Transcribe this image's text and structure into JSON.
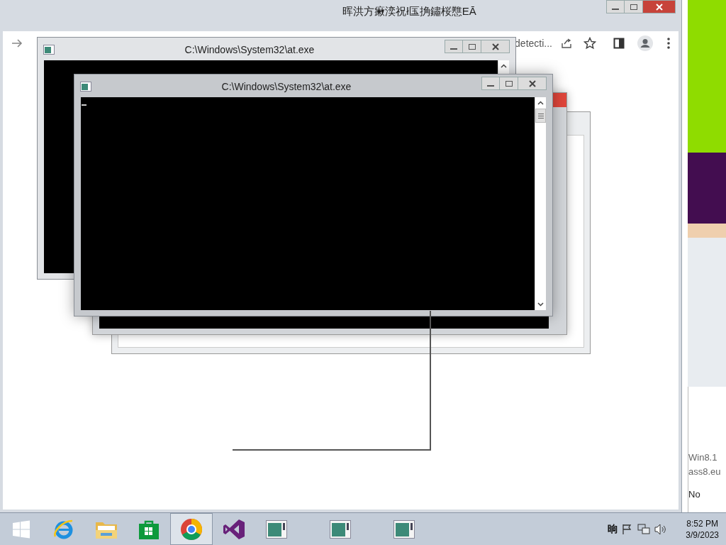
{
  "browser": {
    "title": "晖洪方瘷湙祝ł匤捔鏽桜戁EĀ",
    "address_text": "detecti..."
  },
  "console_windows": [
    {
      "title": "C:\\Windows\\System32\\at.exe",
      "active": false
    },
    {
      "title": "C:\\Windows\\System32\\at.exe",
      "active": true
    }
  ],
  "side_panel": {
    "lines": [
      "Win8.1",
      "ass8.eu",
      "No"
    ]
  },
  "taskbar": {
    "apps": [
      {
        "kind": "start",
        "selected": false
      },
      {
        "kind": "ie",
        "selected": false
      },
      {
        "kind": "explorer",
        "selected": false
      },
      {
        "kind": "store",
        "selected": false
      },
      {
        "kind": "chrome",
        "selected": true
      },
      {
        "kind": "vs",
        "selected": false
      },
      {
        "kind": "console",
        "selected": false
      },
      {
        "kind": "console",
        "selected": false
      },
      {
        "kind": "console",
        "selected": false
      }
    ],
    "ime": "晌",
    "time": "8:52 PM",
    "date": "3/9/2023"
  }
}
